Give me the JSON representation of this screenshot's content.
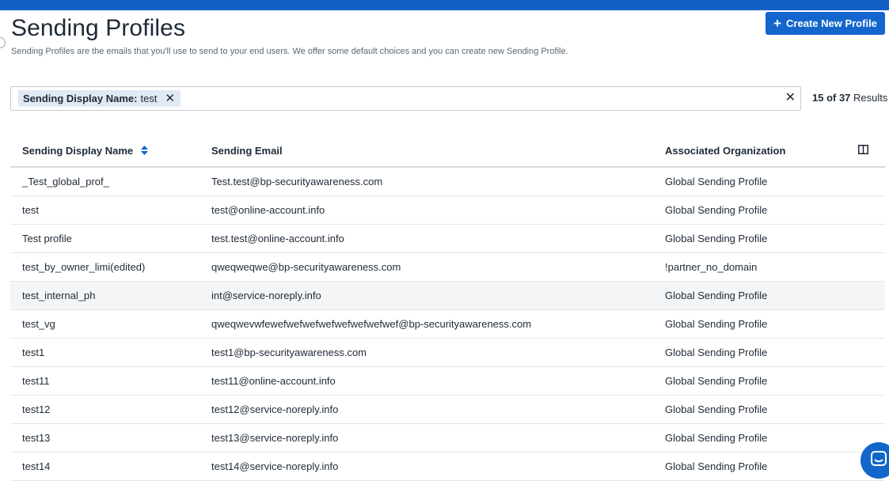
{
  "header": {
    "title": "Sending Profiles",
    "subtitle": "Sending Profiles are the emails that you'll use to send to your end users. We offer some default choices and you can create new Sending Profile.",
    "create_button_label": "Create New Profile"
  },
  "filter": {
    "chip_key": "Sending Display Name:",
    "chip_value": "test"
  },
  "results": {
    "shown": "15 of 37",
    "label": "Results"
  },
  "table": {
    "columns": [
      "Sending Display Name",
      "Sending Email",
      "Associated Organization"
    ],
    "rows": [
      {
        "name": "_Test_global_prof_",
        "email": "Test.test@bp-securityawareness.com",
        "org": "Global Sending Profile"
      },
      {
        "name": "test",
        "email": "test@online-account.info",
        "org": "Global Sending Profile"
      },
      {
        "name": "Test profile",
        "email": "test.test@online-account.info",
        "org": "Global Sending Profile"
      },
      {
        "name": "test_by_owner_limi(edited)",
        "email": "qweqweqwe@bp-securityawareness.com",
        "org": "!partner_no_domain"
      },
      {
        "name": "test_internal_ph",
        "email": "int@service-noreply.info",
        "org": "Global Sending Profile"
      },
      {
        "name": "test_vg",
        "email": "qweqwevwfewefwefwefwefwefwefwefwef@bp-securityawareness.com",
        "org": "Global Sending Profile"
      },
      {
        "name": "test1",
        "email": "test1@bp-securityawareness.com",
        "org": "Global Sending Profile"
      },
      {
        "name": "test11",
        "email": "test11@online-account.info",
        "org": "Global Sending Profile"
      },
      {
        "name": "test12",
        "email": "test12@service-noreply.info",
        "org": "Global Sending Profile"
      },
      {
        "name": "test13",
        "email": "test13@service-noreply.info",
        "org": "Global Sending Profile"
      },
      {
        "name": "test14",
        "email": "test14@service-noreply.info",
        "org": "Global Sending Profile"
      }
    ]
  },
  "icons": {
    "plus": "plus-icon",
    "chip_close": "close-icon",
    "clear": "clear-icon",
    "sort": "sort-icon",
    "columns": "columns-icon",
    "chat": "chat-icon"
  },
  "colors": {
    "brand": "#1466cc",
    "top_bar": "#1060c8",
    "chip_bg": "#e1e9f5",
    "hover_row": "#f4f5f6"
  }
}
